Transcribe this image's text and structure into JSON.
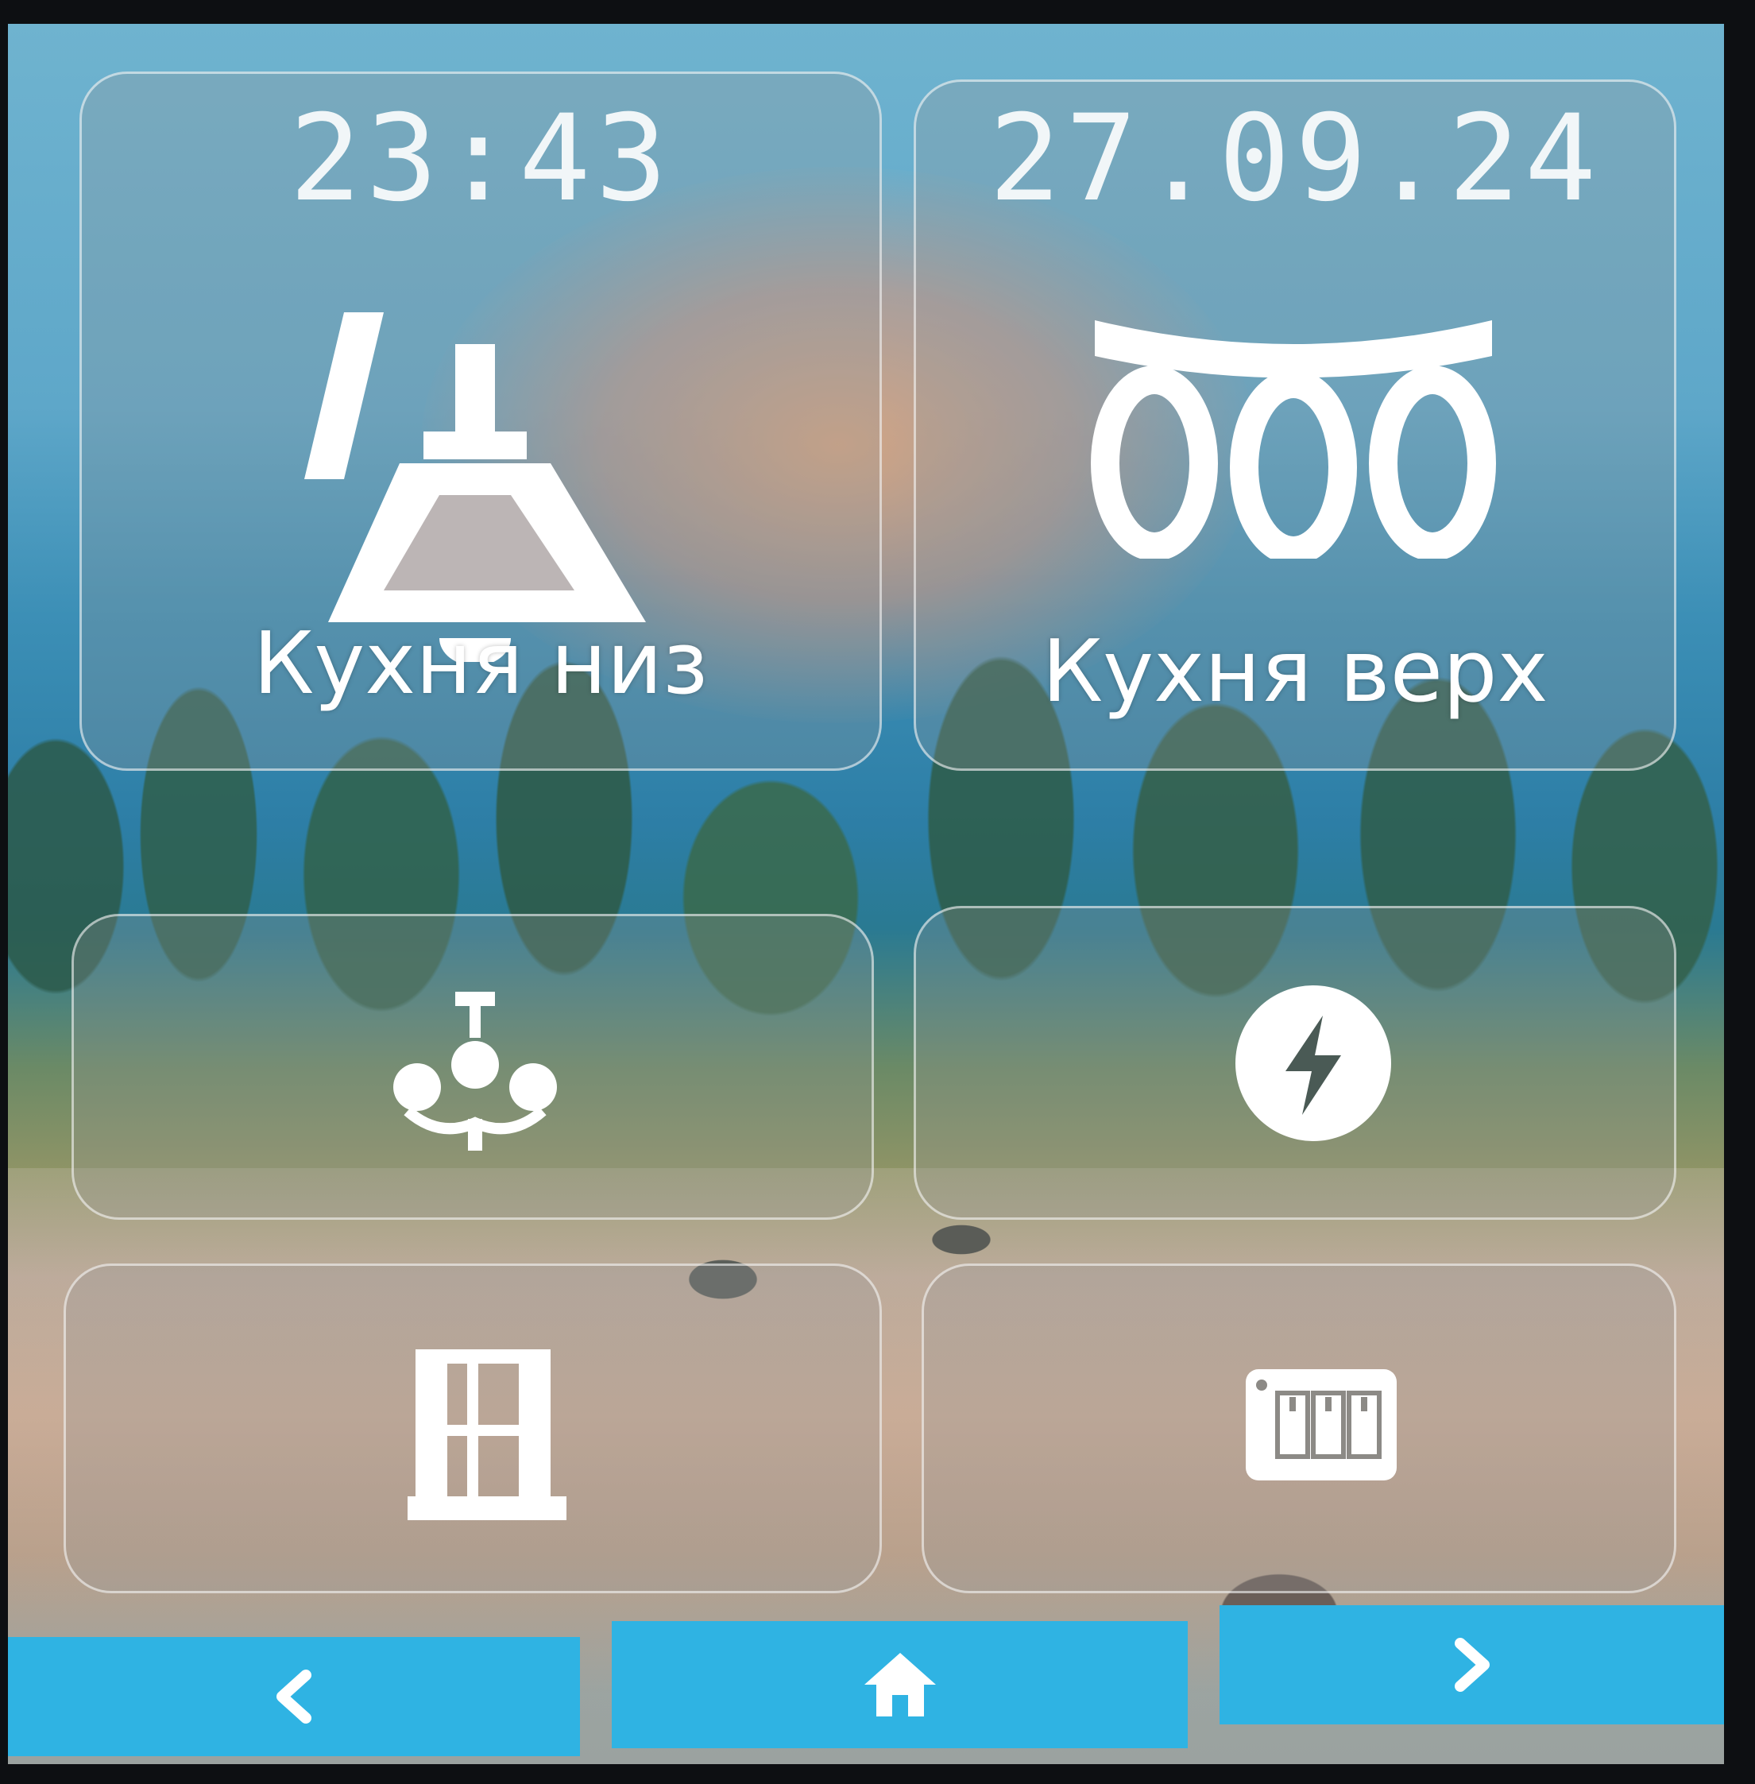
{
  "status": {
    "time": "23:43",
    "date": "27.09.24"
  },
  "tiles": [
    {
      "label": "Кухня низ",
      "icon": "pendant-lamp-icon"
    },
    {
      "label": "Кухня верх",
      "icon": "three-spot-lamp-icon"
    },
    {
      "label": "",
      "icon": "chandelier-icon"
    },
    {
      "label": "",
      "icon": "power-bolt-icon"
    },
    {
      "label": "",
      "icon": "window-icon"
    },
    {
      "label": "",
      "icon": "switch-panel-icon"
    }
  ],
  "navbar": {
    "back_icon": "chevron-left-icon",
    "home_icon": "home-icon",
    "forward_icon": "chevron-right-icon",
    "color": "#2fb3e3"
  }
}
